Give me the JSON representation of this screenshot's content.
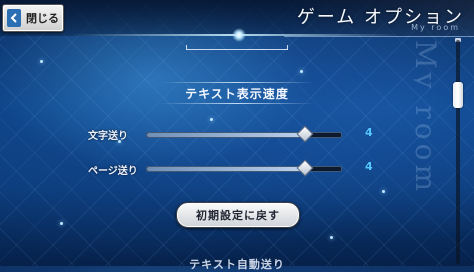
{
  "header": {
    "close_label": "閉じる",
    "title": "ゲーム オプション",
    "subtitle": "My room"
  },
  "section": {
    "title": "テキスト表示速度",
    "next_title": "テキスト自動送り"
  },
  "sliders": [
    {
      "label": "文字送り",
      "value": "4",
      "fraction": 0.81
    },
    {
      "label": "ページ送り",
      "value": "4",
      "fraction": 0.81
    }
  ],
  "reset_button": {
    "label": "初期設定に戻す"
  },
  "watermark": "My room",
  "colors": {
    "value_text": "#58c6ff",
    "accent_blue": "#2a6fb4"
  },
  "icons": {
    "close": "back-arrow-icon"
  }
}
